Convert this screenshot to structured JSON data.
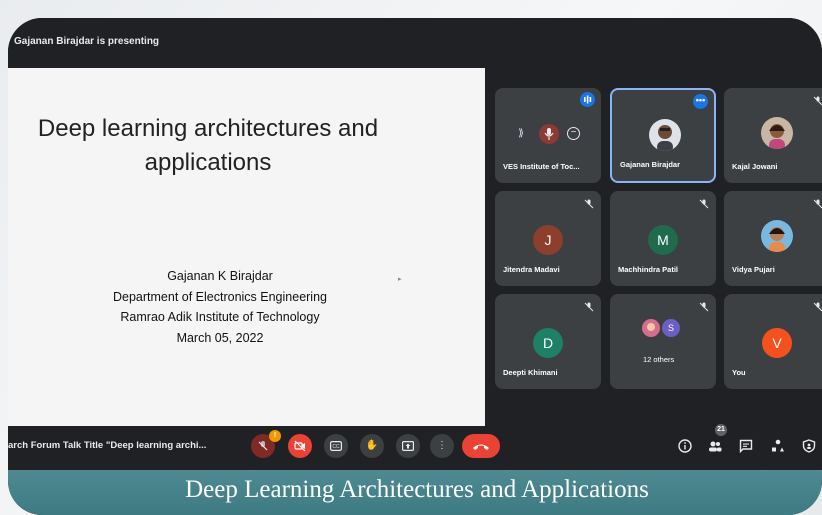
{
  "presenting_banner": "Gajanan Birajdar is presenting",
  "slide": {
    "title_line1": "Deep learning architectures and",
    "title_line2": "applications",
    "author": "Gajanan K Birajdar",
    "department": "Department of Electronics Engineering",
    "institute": "Ramrao Adik Institute of Technology",
    "date": "March 05, 2022"
  },
  "participants": [
    {
      "name": "VES Institute of Toc...",
      "state": "speaking",
      "icon": "audio-bars-icon"
    },
    {
      "name": "Gajanan Birajdar",
      "state": "active",
      "icon": "more-dots-icon"
    },
    {
      "name": "Kajal Jowani",
      "state": "muted",
      "icon": "mic-off-icon"
    },
    {
      "name": "Jitendra Madavi",
      "initial": "J",
      "avatar_color": "#8d3f2e",
      "state": "muted"
    },
    {
      "name": "Machhindra Patil",
      "initial": "M",
      "avatar_color": "#1e6b4e",
      "state": "muted"
    },
    {
      "name": "Vidya Pujari",
      "state": "muted"
    },
    {
      "name": "Deepti Khimani",
      "initial": "D",
      "avatar_color": "#1e8066",
      "state": "muted"
    },
    {
      "name": "12 others",
      "initial": "S",
      "avatar_color": "#6b5fc7",
      "state": "muted"
    },
    {
      "name": "You",
      "initial": "V",
      "avatar_color": "#f4511e",
      "state": "muted"
    }
  ],
  "tile_hover_controls": [
    "pin-icon",
    "mic-icon",
    "remove-icon"
  ],
  "bottom_bar": {
    "meeting_title": "arch Forum Talk Title \"Deep learning archi...",
    "mic_badge": "!",
    "people_count": "21",
    "controls": [
      "mic-off-icon",
      "camera-off-icon",
      "captions-icon",
      "raise-hand-icon",
      "present-icon",
      "more-options-icon",
      "leave-call-icon"
    ],
    "right_icons": [
      "info-icon",
      "people-icon",
      "chat-icon",
      "activities-icon",
      "host-controls-icon"
    ]
  },
  "caption": "Deep Learning Architectures and Applications",
  "colors": {
    "accent": "#8ab4f8",
    "danger": "#ea4335",
    "tile": "#3c4043",
    "bg": "#202124",
    "caption": "#4f8a92"
  }
}
